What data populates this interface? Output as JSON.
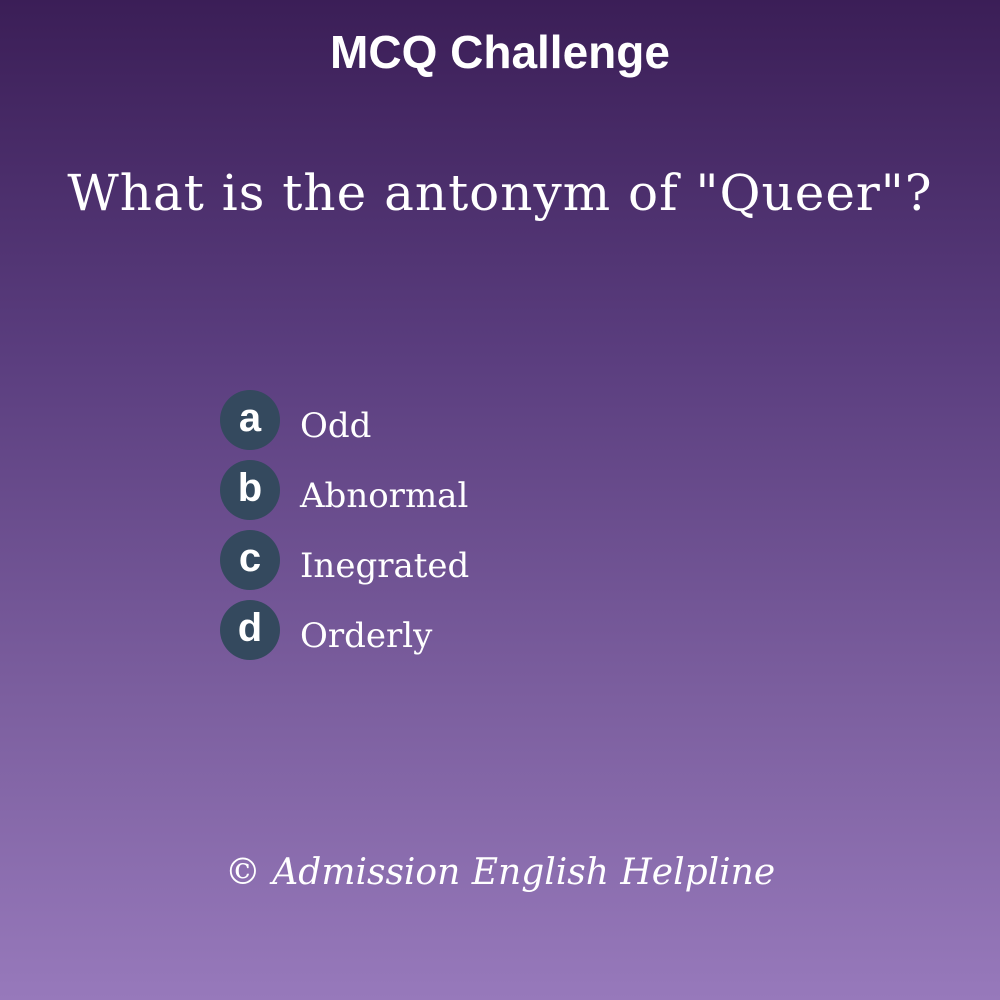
{
  "header": {
    "title": "MCQ Challenge"
  },
  "question": {
    "text": "What is the antonym of \"Queer\"?"
  },
  "options": [
    {
      "letter": "a",
      "text": "Odd"
    },
    {
      "letter": "b",
      "text": "Abnormal"
    },
    {
      "letter": "c",
      "text": "Inegrated"
    },
    {
      "letter": "d",
      "text": "Orderly"
    }
  ],
  "footer": {
    "text": "© Admission English Helpline"
  },
  "colors": {
    "background_top": "#3b1e57",
    "background_bottom": "#9779bb",
    "letter_badge": "#34495e",
    "text": "#ffffff"
  }
}
